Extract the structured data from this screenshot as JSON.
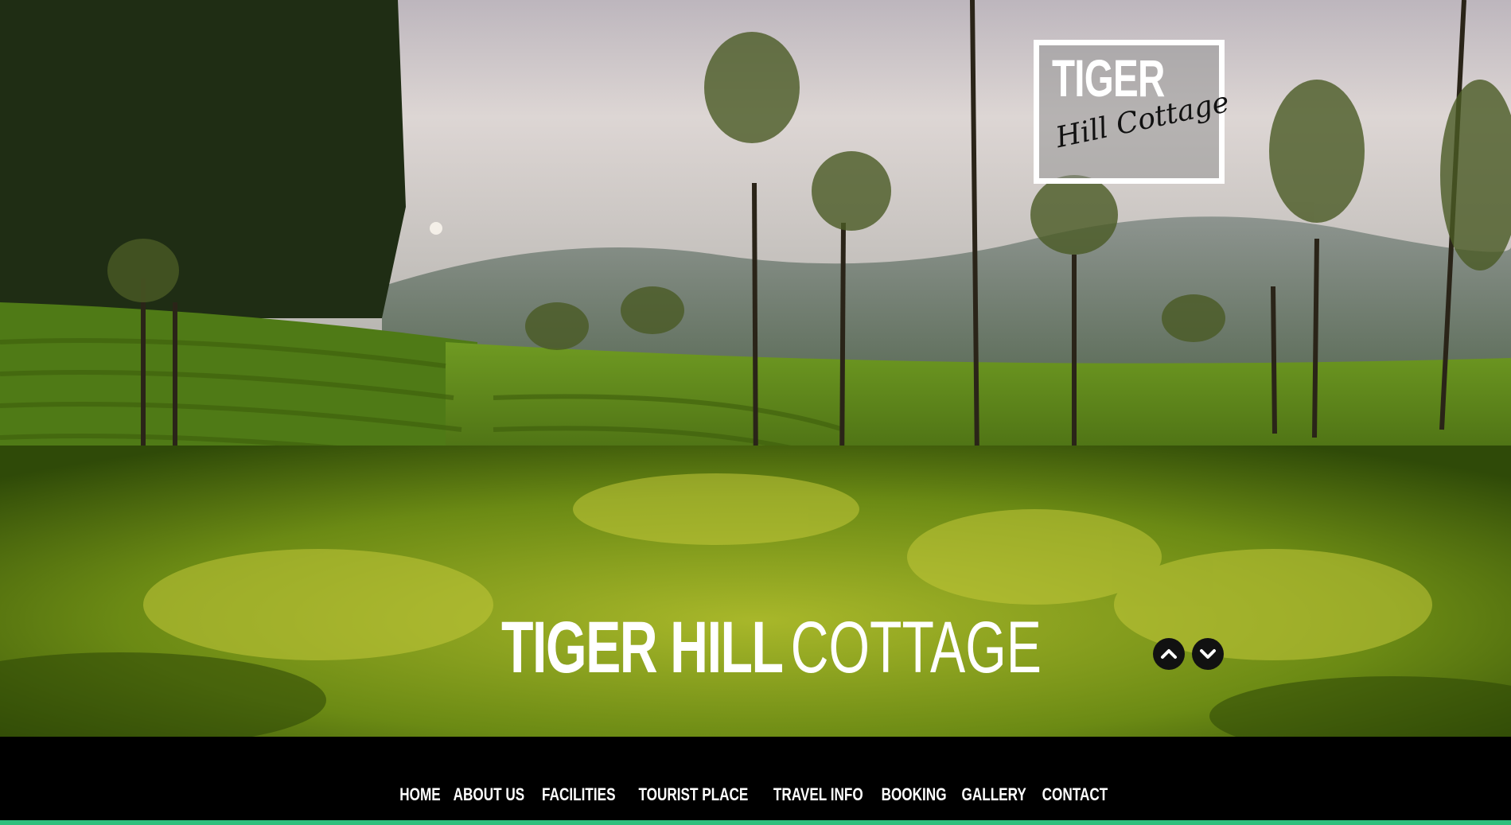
{
  "logo": {
    "line1": "TIGER",
    "line2": "Hill Cottage"
  },
  "hero": {
    "title_bold": "TIGER HILL",
    "title_light": "COTTAGE"
  },
  "slider_controls": {
    "prev_icon": "chevron-up-icon",
    "next_icon": "chevron-down-icon"
  },
  "nav": {
    "items": [
      {
        "label": "HOME"
      },
      {
        "label": "ABOUT US"
      },
      {
        "label": "FACILITIES"
      },
      {
        "label": "TOURIST PLACE"
      },
      {
        "label": "TRAVEL INFO"
      },
      {
        "label": "BOOKING"
      },
      {
        "label": "GALLERY"
      },
      {
        "label": "CONTACT"
      }
    ]
  },
  "colors": {
    "nav_background": "#000000",
    "accent_bar": "#2fbf7d",
    "text": "#ffffff"
  }
}
